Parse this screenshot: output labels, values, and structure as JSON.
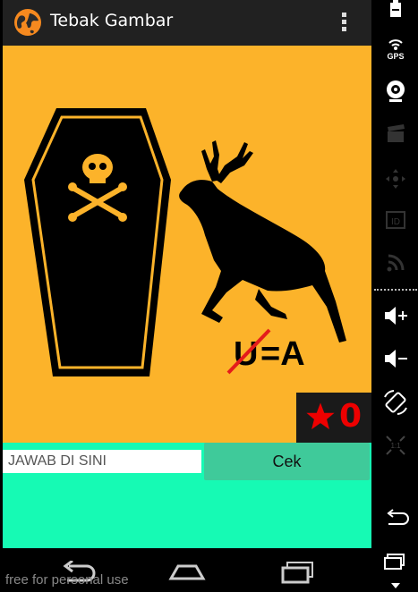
{
  "app": {
    "title": "Tebak Gambar",
    "icon": "globe-app-icon",
    "menu_icon": "overflow-menu-icon"
  },
  "puzzle": {
    "background_color": "#FCB32A",
    "image_elements": [
      "coffin-with-skull-icon",
      "leaping-deer-icon"
    ],
    "hint_text": {
      "struck_letter": "U",
      "equation": "=A"
    },
    "score": {
      "star_icon": "star-icon",
      "value": "0"
    }
  },
  "answer": {
    "placeholder": "JAWAB DI SINI",
    "value": "",
    "check_label": "Cek",
    "area_color": "#16FAB4",
    "button_color": "#3FCA9A"
  },
  "navbar": {
    "buttons": [
      "back-nav-icon",
      "home-nav-icon",
      "recent-apps-nav-icon"
    ]
  },
  "watermark": "free for personal use",
  "emulator_sidebar": {
    "items": [
      "battery-icon",
      "gps-icon",
      "webcam-icon",
      "clapperboard-icon",
      "dpad-icon",
      "id-icon",
      "rss-icon",
      "volume-up-icon",
      "volume-down-icon",
      "rotate-icon",
      "scale-icon",
      "back-icon",
      "recent-icon",
      "more-icon"
    ],
    "gps_label": "GPS",
    "id_label": "ID"
  }
}
